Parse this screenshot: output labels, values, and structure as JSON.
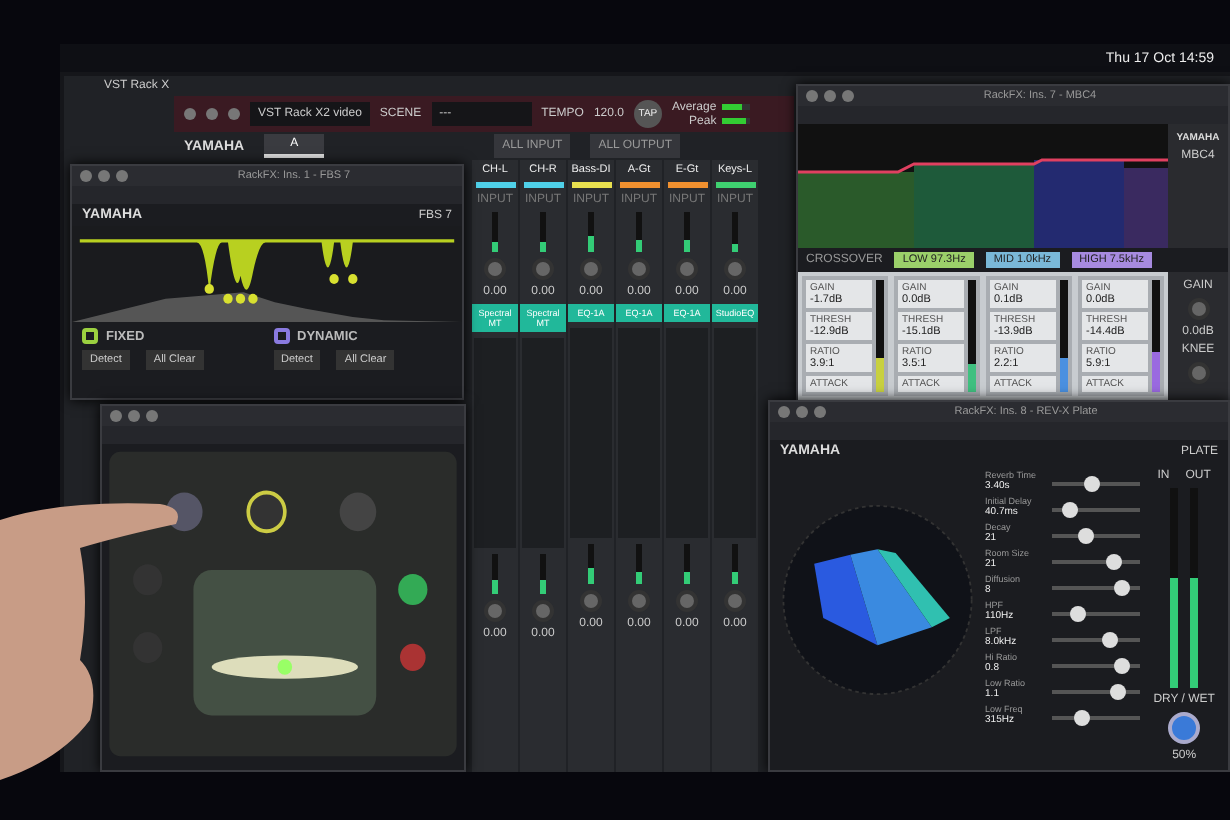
{
  "menubar": {
    "clock": "Thu 17 Oct 14:59"
  },
  "rack": {
    "title": "VST Rack X",
    "file": "VST Rack X2 video",
    "scene_label": "SCENE",
    "scene": "---",
    "tempo_label": "TEMPO",
    "tempo": "120.0",
    "tap": "TAP",
    "brand": "YAMAHA",
    "meters": [
      {
        "label": "Average",
        "level": 0.7
      },
      {
        "label": "Peak",
        "level": 0.85
      }
    ],
    "tabs": [
      {
        "label": "A",
        "selected": true
      }
    ],
    "buttons": [
      "ALL INPUT",
      "ALL OUTPUT"
    ]
  },
  "channels": [
    {
      "name": "CH-L",
      "color": "#4fd0e8",
      "input": "INPUT",
      "level": 0.25,
      "value": "0.00",
      "insert": "Spectral MT",
      "output": {
        "level": 0.35,
        "value": "0.00"
      }
    },
    {
      "name": "CH-R",
      "color": "#4fd0e8",
      "input": "INPUT",
      "level": 0.25,
      "value": "0.00",
      "insert": "Spectral MT",
      "output": {
        "level": 0.35,
        "value": "0.00"
      }
    },
    {
      "name": "Bass-DI",
      "color": "#e8e04f",
      "input": "INPUT",
      "level": 0.4,
      "value": "0.00",
      "insert": "EQ-1A",
      "output": {
        "level": 0.4,
        "value": "0.00"
      }
    },
    {
      "name": "A-Gt",
      "color": "#f0902f",
      "input": "INPUT",
      "level": 0.3,
      "value": "0.00",
      "insert": "EQ-1A",
      "output": {
        "level": 0.3,
        "value": "0.00"
      }
    },
    {
      "name": "E-Gt",
      "color": "#f0902f",
      "input": "INPUT",
      "level": 0.3,
      "value": "0.00",
      "insert": "EQ-1A",
      "output": {
        "level": 0.3,
        "value": "0.00"
      }
    },
    {
      "name": "Keys-L",
      "color": "#3fd070",
      "input": "INPUT",
      "level": 0.2,
      "value": "0.00",
      "insert": "StudioEQ",
      "output": {
        "level": 0.3,
        "value": "0.00"
      }
    }
  ],
  "fbs": {
    "title": "RackFX: Ins. 1 - FBS 7",
    "brand": "YAMAHA",
    "model": "FBS 7",
    "modes": [
      {
        "label": "FIXED",
        "color": "#9bd040",
        "buttons": [
          "Detect",
          "All Clear"
        ]
      },
      {
        "label": "DYNAMIC",
        "color": "#8a7ae0",
        "buttons": [
          "Detect",
          "All Clear"
        ]
      }
    ]
  },
  "mbc": {
    "title": "RackFX: Ins. 7 - MBC4",
    "brand": "YAMAHA",
    "model": "MBC4",
    "crossover": "CROSSOVER",
    "band_labels": [
      {
        "text": "LOW 97.3Hz",
        "color": "#9bd06a"
      },
      {
        "text": "MID 1.0kHz",
        "color": "#7ab8d8"
      },
      {
        "text": "HIGH 7.5kHz",
        "color": "#a78be0"
      }
    ],
    "bands": [
      {
        "color": "#c8d040",
        "level": 0.3,
        "rows": [
          {
            "label": "GAIN",
            "value": "-1.7dB"
          },
          {
            "label": "THRESH",
            "value": "-12.9dB"
          },
          {
            "label": "RATIO",
            "value": "3.9:1"
          },
          {
            "label": "ATTACK"
          }
        ]
      },
      {
        "color": "#40c080",
        "level": 0.25,
        "rows": [
          {
            "label": "GAIN",
            "value": "0.0dB"
          },
          {
            "label": "THRESH",
            "value": "-15.1dB"
          },
          {
            "label": "RATIO",
            "value": "3.5:1"
          },
          {
            "label": "ATTACK"
          }
        ]
      },
      {
        "color": "#4a90e0",
        "level": 0.3,
        "rows": [
          {
            "label": "GAIN",
            "value": "0.1dB"
          },
          {
            "label": "THRESH",
            "value": "-13.9dB"
          },
          {
            "label": "RATIO",
            "value": "2.2:1"
          },
          {
            "label": "ATTACK"
          }
        ]
      },
      {
        "color": "#9a6ae0",
        "level": 0.35,
        "rows": [
          {
            "label": "GAIN",
            "value": "0.0dB"
          },
          {
            "label": "THRESH",
            "value": "-14.4dB"
          },
          {
            "label": "RATIO",
            "value": "5.9:1"
          },
          {
            "label": "ATTACK"
          }
        ]
      }
    ],
    "out_label": "GAIN",
    "out_value": "0.0dB",
    "knee": "KNEE"
  },
  "rev": {
    "title": "RackFX: Ins. 8 - REV-X Plate",
    "brand": "YAMAHA",
    "model": "PLATE",
    "params": [
      {
        "label": "Reverb Time",
        "value": "3.40s",
        "level": 0.45
      },
      {
        "label": "Initial Delay",
        "value": "40.7ms",
        "level": 0.22
      },
      {
        "label": "Decay",
        "value": "21",
        "level": 0.4
      },
      {
        "label": "Room Size",
        "value": "21",
        "level": 0.7
      },
      {
        "label": "Diffusion",
        "value": "8",
        "level": 0.8
      },
      {
        "label": "HPF",
        "value": "110Hz",
        "level": 0.3
      },
      {
        "label": "LPF",
        "value": "8.0kHz",
        "level": 0.65
      },
      {
        "label": "Hi Ratio",
        "value": "0.8",
        "level": 0.8
      },
      {
        "label": "Low Ratio",
        "value": "1.1",
        "level": 0.75
      },
      {
        "label": "Low Freq",
        "value": "315Hz",
        "level": 0.35
      }
    ],
    "meters": [
      {
        "label": "IN",
        "level": 0.55
      },
      {
        "label": "OUT",
        "level": 0.55
      }
    ],
    "dry_wet": "DRY / WET",
    "mix": "50%"
  }
}
